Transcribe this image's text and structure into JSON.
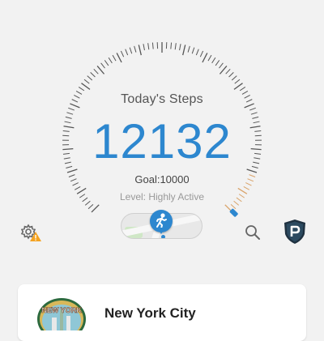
{
  "gauge": {
    "title": "Today's Steps",
    "steps": "12132",
    "goal_label": "Goal:10000",
    "level_label": "Level: Highly Active",
    "progress_fraction": 1.0,
    "accent_color": "#2d87cf",
    "highlight_color": "#d9a36a"
  },
  "toolbar": {
    "settings_icon": "settings-warning-icon",
    "map_icon": "map-walk-icon",
    "search_icon": "search-icon",
    "profile_icon": "profile-p-icon"
  },
  "location_card": {
    "city_name": "New York City",
    "badge_text": "NEW YORK",
    "badge_icon": "new-york-badge-icon"
  }
}
